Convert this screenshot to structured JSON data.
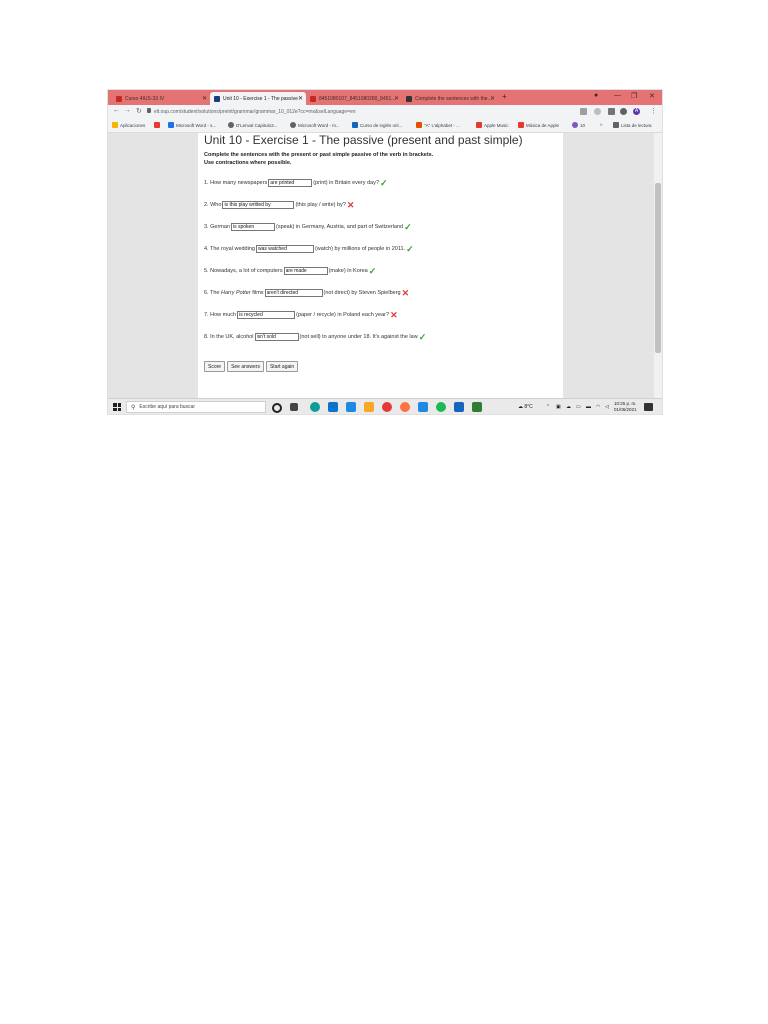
{
  "browser": {
    "tabs": [
      {
        "label": "Curso 4IUS-33 IV",
        "active": false
      },
      {
        "label": "Unit 10 - Exercise 1 - The passive",
        "active": true
      },
      {
        "label": "8451080107_8451080280_8451...",
        "active": false
      },
      {
        "label": "Complete the sentences with the...",
        "active": false
      }
    ],
    "new_tab_label": "+",
    "url": "elt.oup.com/student/solutions/preint/grammar/grammar_10_012e?cc=mx&selLanguage=en",
    "bookmarks": [
      {
        "label": "Aplicaciones",
        "color": "#f4b400"
      },
      {
        "label": "",
        "color": "#e53935"
      },
      {
        "label": "Microsoft Word - s...",
        "color": "#1a73e8"
      },
      {
        "label": "D'Lenval Capitulo3...",
        "color": "#5f6368"
      },
      {
        "label": "Microsoft Word - m...",
        "color": "#5f6368"
      },
      {
        "label": "Curso de inglés onl...",
        "color": "#1565c0"
      },
      {
        "label": "\"A\" L'alphabet - ...",
        "color": "#e65100"
      },
      {
        "label": "Apple Music",
        "color": "#e53935"
      },
      {
        "label": "Música de Apple",
        "color": "#e53935"
      },
      {
        "label": "10",
        "color": "#7e57c2"
      },
      {
        "label": "Lista de lectura",
        "color": "#5f6368"
      }
    ],
    "profile_initial": "A"
  },
  "page": {
    "title": "Unit 10 - Exercise 1 - The passive (present and past simple)",
    "instructions_line1": "Complete the sentences with the present or past simple passive of the verb in brackets.",
    "instructions_line2": "Use contractions where possible.",
    "questions": [
      {
        "prefix": "1. How many newspapers",
        "answer": "are printed",
        "suffix": "(print) in Britain every day?",
        "correct": true
      },
      {
        "prefix": "2. Who",
        "answer": "is this play writted by",
        "suffix": "(this play / write) by?",
        "correct": false
      },
      {
        "prefix": "3. German",
        "answer": "is spoken",
        "suffix": "(speak) in Germany, Austria, and part of Switzerland",
        "correct": true
      },
      {
        "prefix": "4. The royal wedding",
        "answer": "was watched",
        "suffix": "(watch) by millions of people in 2011.",
        "correct": true
      },
      {
        "prefix": "5. Nowadays, a lot of computers",
        "answer": "are made",
        "suffix": "(make) in Korea",
        "correct": true
      },
      {
        "prefix_a": "6. The ",
        "prefix_em": "Harry Potter",
        "prefix_b": " films",
        "answer": "aren't directed",
        "suffix": "(not direct) by Steven Spielberg",
        "correct": false
      },
      {
        "prefix": "7. How much",
        "answer": "is recycled",
        "suffix": "(paper / recycle) in Poland each year?",
        "correct": false
      },
      {
        "prefix": "8. In the UK, alcohol",
        "answer": "isn't sold",
        "suffix": "(not sell) to anyone under 18. It's against the law",
        "correct": true
      }
    ],
    "buttons": {
      "score": "Score",
      "see_answers": "See answers",
      "start_again": "Start again"
    },
    "marks": {
      "correct": "✓",
      "wrong": "✕"
    }
  },
  "taskbar": {
    "search_placeholder": "Escribe aquí para buscar",
    "temperature": "8°C",
    "time": "10:25 p. m.",
    "date": "01/06/2021"
  }
}
